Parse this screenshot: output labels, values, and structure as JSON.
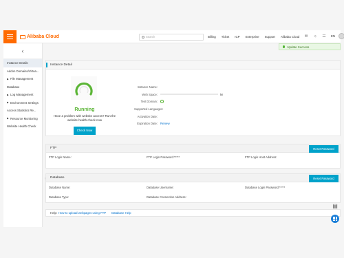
{
  "brand": {
    "name": "Alibaba Cloud",
    "accent": "#ff6a00",
    "primary": "#00a2ca",
    "success": "#5bb536"
  },
  "search": {
    "placeholder": "Search"
  },
  "nav": {
    "items": [
      "Billing",
      "Ticket",
      "ICP",
      "Enterprise",
      "Support",
      "Alibaba Cloud"
    ]
  },
  "header_icons": {
    "lang": "EN",
    "icons": [
      "mail-icon",
      "bell-icon",
      "cart-icon",
      "avatar"
    ]
  },
  "toast": {
    "text": "Update Success"
  },
  "sidebar": {
    "items": [
      {
        "label": "Instance Details",
        "active": true,
        "expandable": false
      },
      {
        "label": "Addon Domains/Virtua...",
        "active": false,
        "expandable": false
      },
      {
        "label": "File Management",
        "active": false,
        "expandable": true
      },
      {
        "label": "Database",
        "active": false,
        "expandable": false
      },
      {
        "label": "Log Management",
        "active": false,
        "expandable": true
      },
      {
        "label": "Environment Settings",
        "active": false,
        "expandable": true
      },
      {
        "label": "Access Statistics Re...",
        "active": false,
        "expandable": false
      },
      {
        "label": "Resource Monitoring",
        "active": false,
        "expandable": true
      },
      {
        "label": "Website Health Check",
        "active": false,
        "expandable": false
      }
    ]
  },
  "instance": {
    "title": "Instance Detail",
    "status": "Running",
    "problem_text": "Have a problem with website access? Run the website health check now",
    "check_button": "Check Now",
    "fields": [
      {
        "label": "Instance Name:",
        "value": ""
      },
      {
        "label": "Web Space:",
        "value": "M",
        "usage": 0.95
      },
      {
        "label": "Test Domain:",
        "value": ""
      },
      {
        "label": "Supported Languages:",
        "value": ""
      },
      {
        "label": "Activation Date:",
        "value": ""
      },
      {
        "label": "Expiration Date:",
        "value": "Renew"
      }
    ]
  },
  "ftp": {
    "title": "FTP",
    "button": "Reset Password",
    "login_name": "FTP Login Name:",
    "login_password": "FTP Login Password:*****",
    "login_host": "FTP Login Host Address:"
  },
  "database": {
    "title": "Database",
    "button": "Reset Password",
    "name": "Database Name:",
    "username": "Database Username:",
    "login_password": "Database Login Password:*****",
    "type": "Database Type:",
    "connection": "Database Connection Address:"
  },
  "help": {
    "label": "Help:",
    "links": [
      "How to upload webpages using FTP",
      "Database Help"
    ]
  }
}
